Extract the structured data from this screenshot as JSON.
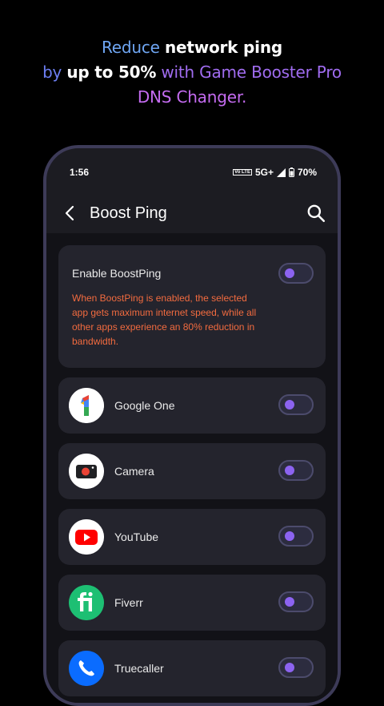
{
  "promo": {
    "line1_a": "Reduce ",
    "line1_b": "network ping",
    "line2_a": "by ",
    "line2_b": "up to 50%",
    "line2_c": " with Game Booster Pro",
    "line3": "DNS Changer."
  },
  "statusbar": {
    "time": "1:56",
    "network": "5G+",
    "battery": "70%",
    "volte": "Vo LTE"
  },
  "appbar": {
    "title": "Boost Ping"
  },
  "enable": {
    "title": "Enable BoostPing",
    "description": "When BoostPing is enabled, the selected app gets maximum internet speed, while all other apps experience an 80% reduction in bandwidth.",
    "enabled": false
  },
  "apps": [
    {
      "name": "Google One",
      "icon": "google-one-icon",
      "enabled": false
    },
    {
      "name": "Camera",
      "icon": "camera-icon",
      "enabled": false
    },
    {
      "name": "YouTube",
      "icon": "youtube-icon",
      "enabled": false
    },
    {
      "name": "Fiverr",
      "icon": "fiverr-icon",
      "enabled": false
    },
    {
      "name": "Truecaller",
      "icon": "truecaller-icon",
      "enabled": false
    }
  ],
  "colors": {
    "accent": "#8c63f0",
    "description": "#f26b3f",
    "card": "#24242d"
  }
}
